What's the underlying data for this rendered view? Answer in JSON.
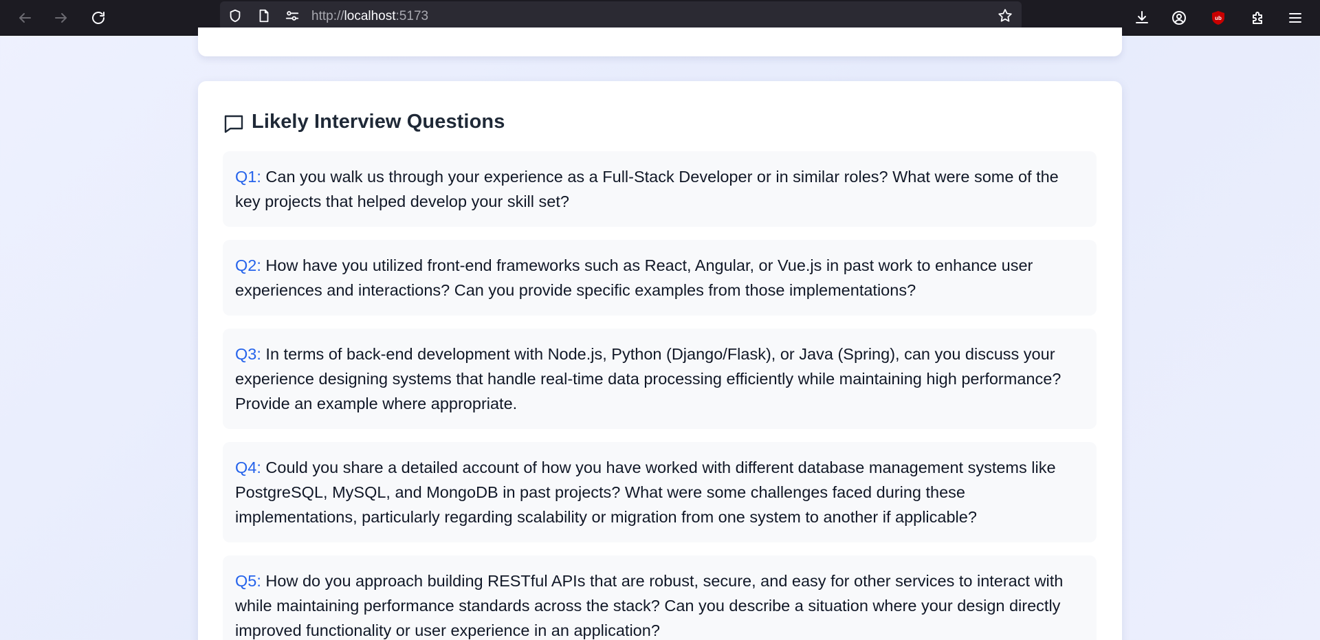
{
  "browser": {
    "url_prefix": "http://",
    "url_host": "localhost",
    "url_port": ":5173",
    "icons": [
      "back-icon",
      "forward-icon",
      "reload-icon",
      "shield-icon",
      "page-icon",
      "permissions-icon",
      "bookmark-star-icon",
      "download-icon",
      "account-icon",
      "ublock-icon",
      "extensions-icon",
      "menu-icon"
    ]
  },
  "section": {
    "title": "Likely Interview Questions",
    "icon": "chat-bubble-icon"
  },
  "questions": [
    {
      "label": "Q1:",
      "text": " Can you walk us through your experience as a Full-Stack Developer or in similar roles? What were some of the key projects that helped develop your skill set?"
    },
    {
      "label": "Q2:",
      "text": " How have you utilized front-end frameworks such as React, Angular, or Vue.js in past work to enhance user experiences and interactions? Can you provide specific examples from those implementations?"
    },
    {
      "label": "Q3:",
      "text": " In terms of back-end development with Node.js, Python (Django/Flask), or Java (Spring), can you discuss your experience designing systems that handle real-time data processing efficiently while maintaining high performance? Provide an example where appropriate."
    },
    {
      "label": "Q4:",
      "text": " Could you share a detailed account of how you have worked with different database management systems like PostgreSQL, MySQL, and MongoDB in past projects? What were some challenges faced during these implementations, particularly regarding scalability or migration from one system to another if applicable?"
    },
    {
      "label": "Q5:",
      "text": " How do you approach building RESTful APIs that are robust, secure, and easy for other services to interact with while maintaining performance standards across the stack? Can you describe a situation where your design directly improved functionality or user experience in an application?"
    }
  ],
  "colors": {
    "accent": "#2563eb",
    "card_bg": "#ffffff",
    "question_bg": "#f8f9fb",
    "toolbar_bg": "#1c1b22"
  }
}
